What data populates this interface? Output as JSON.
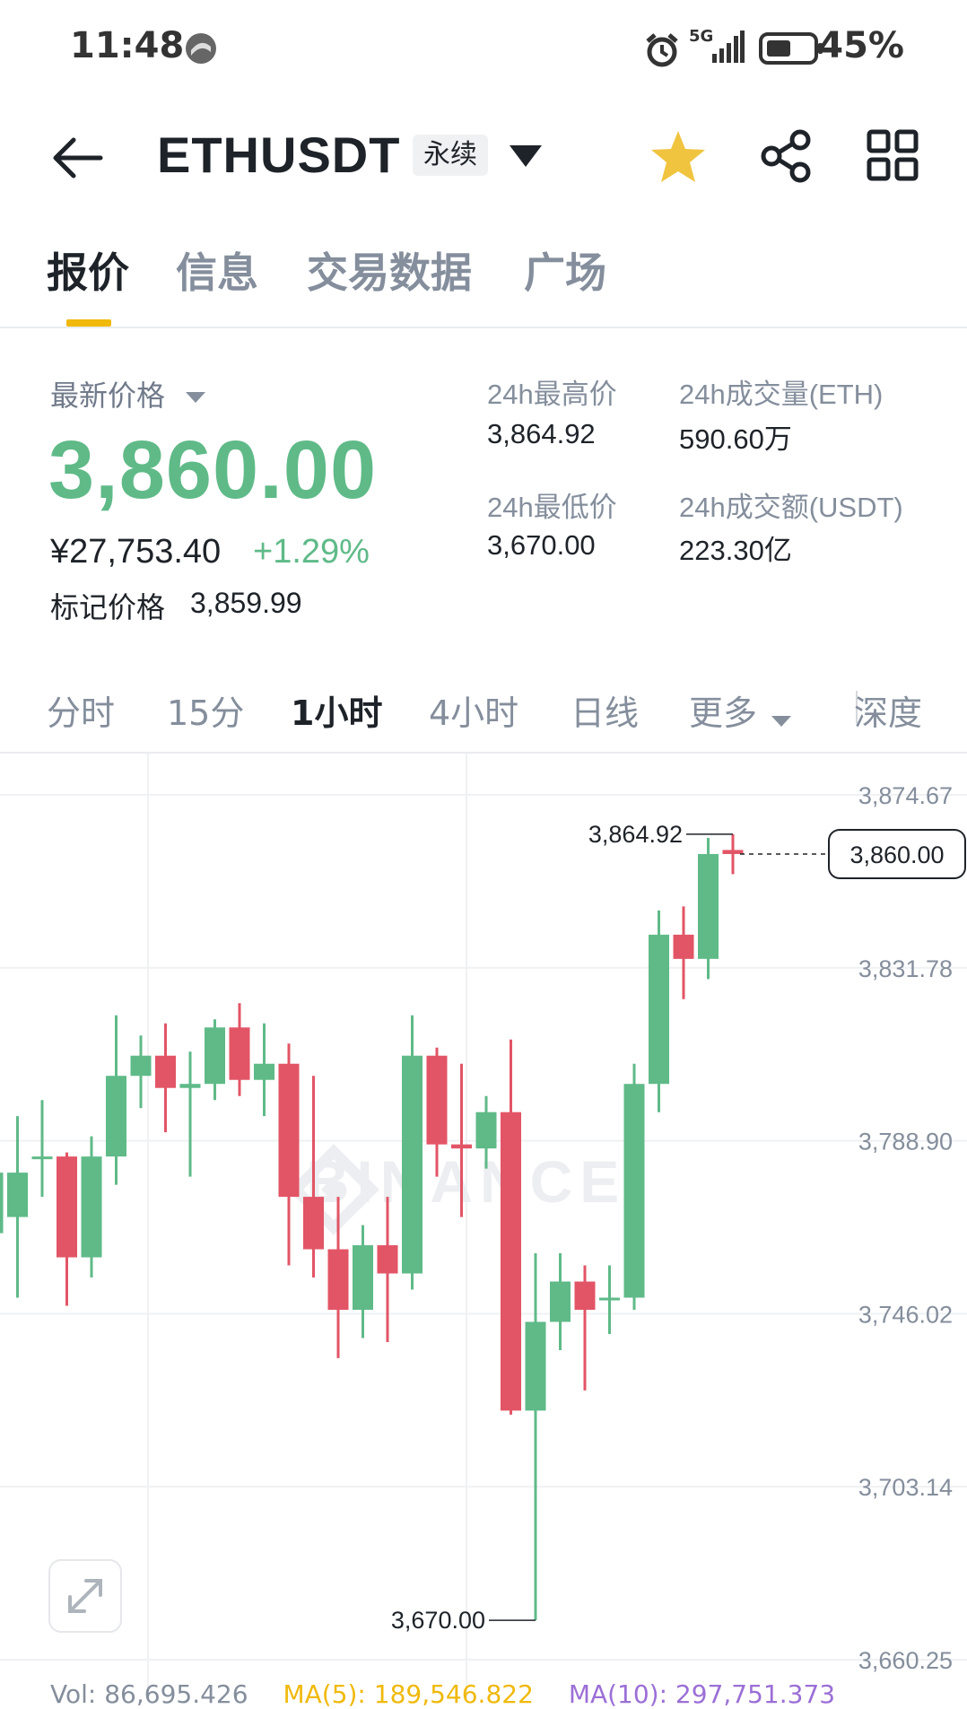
{
  "status_bar": {
    "time": "11:48",
    "network": "5G",
    "battery": "45%"
  },
  "header": {
    "symbol": "ETHUSDT",
    "contract_tag": "永续"
  },
  "tabs": [
    "报价",
    "信息",
    "交易数据",
    "广场"
  ],
  "quote": {
    "latest_label": "最新价格",
    "latest_price": "3,860.00",
    "cny_price": "¥27,753.40",
    "change_pct": "+1.29%",
    "mark_label": "标记价格",
    "mark_price": "3,859.99",
    "high_label": "24h最高价",
    "high": "3,864.92",
    "low_label": "24h最低价",
    "low": "3,670.00",
    "vol_label": "24h成交量(ETH)",
    "vol": "590.60万",
    "turnover_label": "24h成交额(USDT)",
    "turnover": "223.30亿"
  },
  "intervals": [
    "分时",
    "15分",
    "1小时",
    "4小时",
    "日线",
    "更多",
    "深度"
  ],
  "colors": {
    "up": "#5fba88",
    "down": "#e25566",
    "accent": "#f0b90b"
  },
  "chart_data": {
    "type": "candlestick",
    "y_ticks": [
      "3,874.67",
      "3,831.78",
      "3,788.90",
      "3,746.02",
      "3,703.14",
      "3,660.25"
    ],
    "ylim": [
      3660.25,
      3874.67
    ],
    "high_marker": "3,864.92",
    "low_marker": "3,670.00",
    "last_price_tag": "3,860.00",
    "watermark": "BINANCE",
    "candles": [
      {
        "o": 3766,
        "h": 3784,
        "l": 3740,
        "c": 3781
      },
      {
        "o": 3770,
        "h": 3795,
        "l": 3750,
        "c": 3781
      },
      {
        "o": 3785,
        "h": 3799,
        "l": 3775,
        "c": 3785
      },
      {
        "o": 3785,
        "h": 3786,
        "l": 3748,
        "c": 3760
      },
      {
        "o": 3760,
        "h": 3790,
        "l": 3755,
        "c": 3785
      },
      {
        "o": 3785,
        "h": 3820,
        "l": 3778,
        "c": 3805
      },
      {
        "o": 3805,
        "h": 3815,
        "l": 3797,
        "c": 3810
      },
      {
        "o": 3810,
        "h": 3818,
        "l": 3791,
        "c": 3802
      },
      {
        "o": 3802,
        "h": 3811,
        "l": 3780,
        "c": 3803
      },
      {
        "o": 3803,
        "h": 3819,
        "l": 3799,
        "c": 3817
      },
      {
        "o": 3817,
        "h": 3823,
        "l": 3800,
        "c": 3804
      },
      {
        "o": 3804,
        "h": 3818,
        "l": 3795,
        "c": 3808
      },
      {
        "o": 3808,
        "h": 3813,
        "l": 3758,
        "c": 3775
      },
      {
        "o": 3775,
        "h": 3805,
        "l": 3755,
        "c": 3762
      },
      {
        "o": 3762,
        "h": 3775,
        "l": 3735,
        "c": 3747
      },
      {
        "o": 3747,
        "h": 3768,
        "l": 3740,
        "c": 3763
      },
      {
        "o": 3763,
        "h": 3775,
        "l": 3739,
        "c": 3756
      },
      {
        "o": 3756,
        "h": 3820,
        "l": 3752,
        "c": 3810
      },
      {
        "o": 3810,
        "h": 3812,
        "l": 3780,
        "c": 3788
      },
      {
        "o": 3788,
        "h": 3808,
        "l": 3770,
        "c": 3787
      },
      {
        "o": 3787,
        "h": 3800,
        "l": 3782,
        "c": 3796
      },
      {
        "o": 3796,
        "h": 3814,
        "l": 3721,
        "c": 3722
      },
      {
        "o": 3722,
        "h": 3761,
        "l": 3670,
        "c": 3744
      },
      {
        "o": 3744,
        "h": 3761,
        "l": 3737,
        "c": 3754
      },
      {
        "o": 3754,
        "h": 3758,
        "l": 3727,
        "c": 3747
      },
      {
        "o": 3750,
        "h": 3758,
        "l": 3741,
        "c": 3750
      },
      {
        "o": 3750,
        "h": 3808,
        "l": 3747,
        "c": 3803
      },
      {
        "o": 3803,
        "h": 3846,
        "l": 3796,
        "c": 3840
      },
      {
        "o": 3840,
        "h": 3847,
        "l": 3824,
        "c": 3834
      },
      {
        "o": 3834,
        "h": 3864,
        "l": 3829,
        "c": 3860
      },
      {
        "o": 3861,
        "h": 3864.92,
        "l": 3855,
        "c": 3860
      }
    ]
  },
  "indicators": {
    "vol": "Vol: 86,695.426",
    "ma5": "MA(5): 189,546.822",
    "ma10": "MA(10): 297,751.373"
  }
}
